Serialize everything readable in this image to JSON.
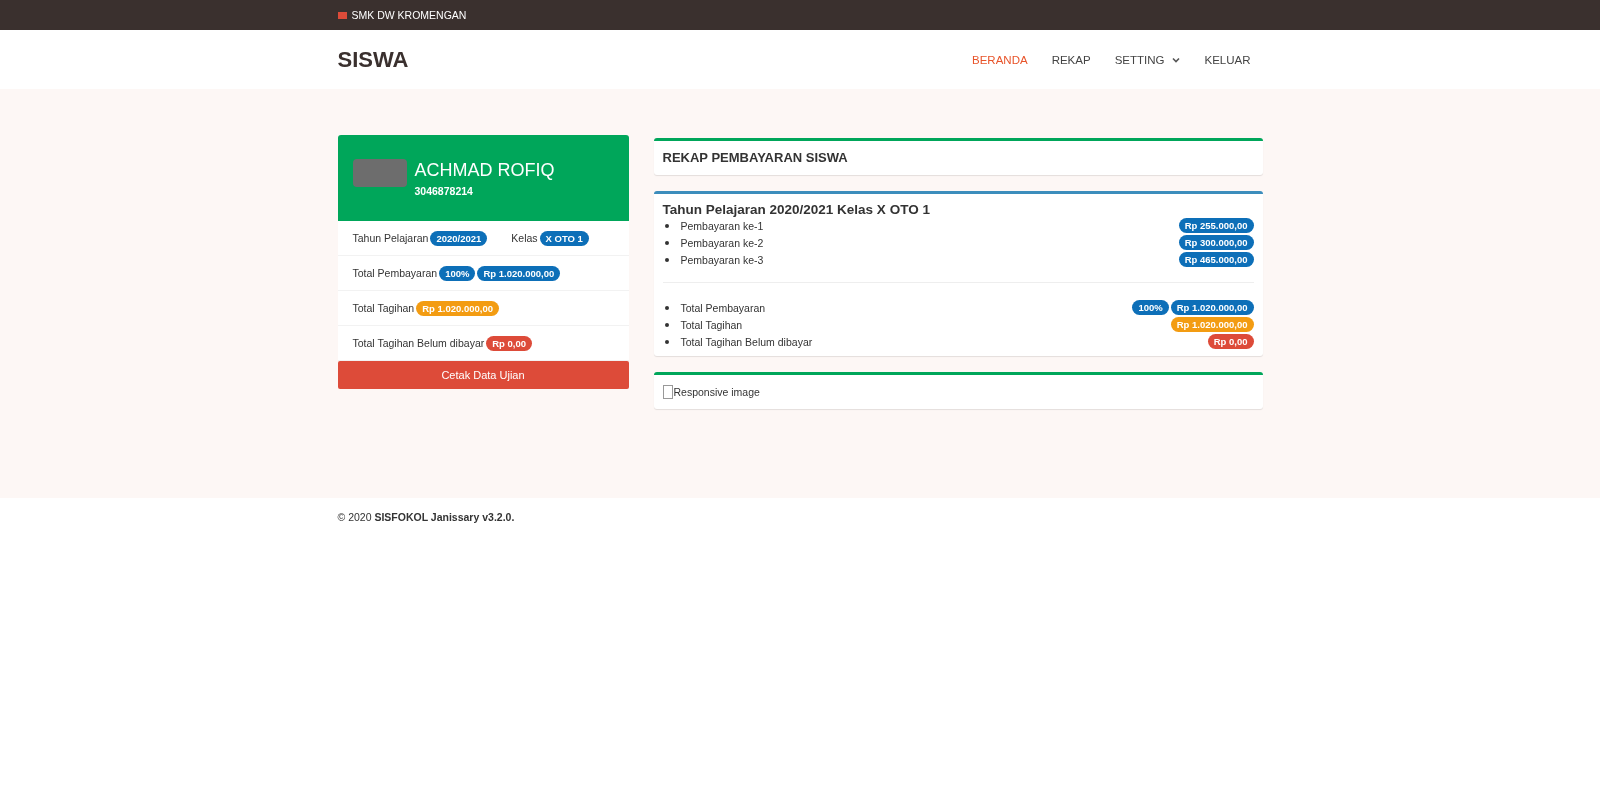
{
  "topbar": {
    "school": "SMK DW KROMENGAN"
  },
  "navbar": {
    "brand": "SISWA",
    "items": [
      {
        "label": "BERANDA",
        "selected": true,
        "dropdown": false
      },
      {
        "label": "REKAP",
        "selected": false,
        "dropdown": false
      },
      {
        "label": "SETTING",
        "selected": false,
        "dropdown": true
      },
      {
        "label": "KELUAR",
        "selected": false,
        "dropdown": false
      }
    ]
  },
  "profile": {
    "name": "ACHMAD ROFIQ",
    "nis": "3046878214",
    "rows": [
      {
        "label": "Tahun Pelajaran",
        "badges": [
          {
            "text": "2020/2021",
            "color": "#0d6fb8"
          }
        ],
        "extra_label": "Kelas",
        "extra_badges": [
          {
            "text": "X OTO 1",
            "color": "#0d6fb8"
          }
        ]
      },
      {
        "label": "Total Pembayaran",
        "badges": [
          {
            "text": "100%",
            "color": "#0d6fb8"
          },
          {
            "text": "Rp 1.020.000,00",
            "color": "#0d6fb8"
          }
        ]
      },
      {
        "label": "Total Tagihan",
        "badges": [
          {
            "text": "Rp 1.020.000,00",
            "color": "#f39c12"
          }
        ]
      },
      {
        "label": "Total Tagihan Belum dibayar",
        "badges": [
          {
            "text": "Rp 0,00",
            "color": "#dd4b39"
          }
        ]
      }
    ],
    "button": "Cetak Data Ujian"
  },
  "rekap": {
    "title": "REKAP PEMBAYARAN SISWA",
    "heading": "Tahun Pelajaran 2020/2021 Kelas X OTO 1",
    "payments": [
      {
        "label": "Pembayaran ke-1",
        "badges": [
          {
            "text": "Rp 255.000,00",
            "color": "#0d6fb8"
          }
        ]
      },
      {
        "label": "Pembayaran ke-2",
        "badges": [
          {
            "text": "Rp 300.000,00",
            "color": "#0d6fb8"
          }
        ]
      },
      {
        "label": "Pembayaran ke-3",
        "badges": [
          {
            "text": "Rp 465.000,00",
            "color": "#0d6fb8"
          }
        ]
      }
    ],
    "totals": [
      {
        "label": "Total Pembayaran",
        "badges": [
          {
            "text": "100%",
            "color": "#0d6fb8"
          },
          {
            "text": "Rp 1.020.000,00",
            "color": "#0d6fb8"
          }
        ]
      },
      {
        "label": "Total Tagihan",
        "badges": [
          {
            "text": "Rp 1.020.000,00",
            "color": "#f39c12"
          }
        ]
      },
      {
        "label": "Total Tagihan Belum dibayar",
        "badges": [
          {
            "text": "Rp 0,00",
            "color": "#dd4b39"
          }
        ]
      }
    ],
    "image_alt": "Responsive image"
  },
  "footer": {
    "text": "© 2020 **SISFOKOL Janissary v3.2.0.**"
  }
}
